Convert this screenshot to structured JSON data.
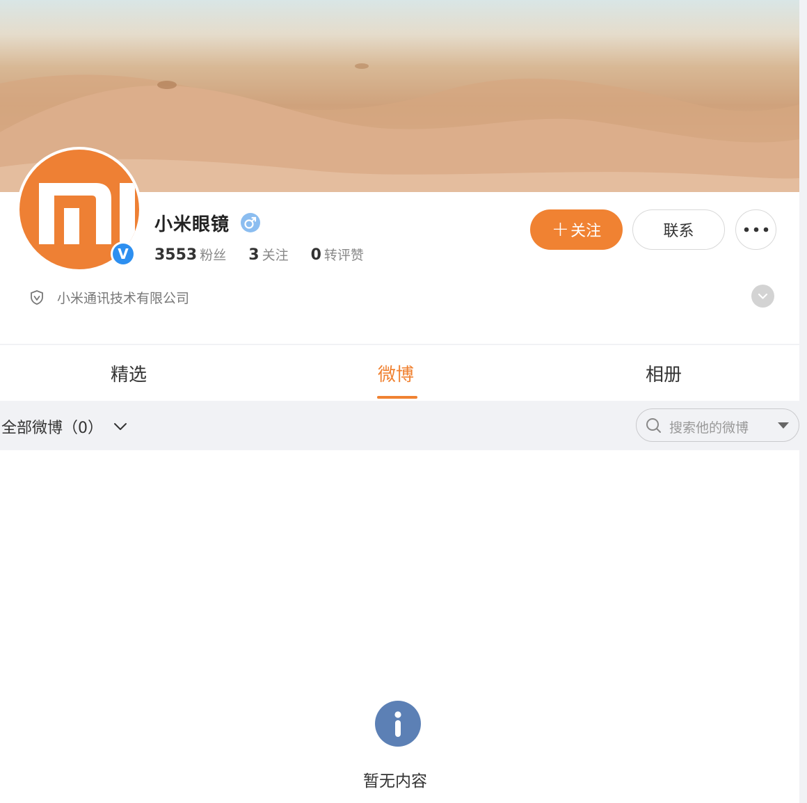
{
  "profile": {
    "name": "小米眼镜",
    "stats": [
      {
        "num": "3553",
        "label": "粉丝"
      },
      {
        "num": "3",
        "label": "关注"
      },
      {
        "num": "0",
        "label": "转评赞"
      }
    ],
    "company": "小米通讯技术有限公司"
  },
  "actions": {
    "follow_plus": "+",
    "follow_label": "关注",
    "contact_label": "联系"
  },
  "tabs": [
    {
      "label": "精选"
    },
    {
      "label": "微博"
    },
    {
      "label": "相册"
    }
  ],
  "filter": {
    "label": "全部微博（0）",
    "search_placeholder": "搜索他的微博"
  },
  "empty": {
    "text": "暂无内容"
  },
  "colors": {
    "accent": "#f08232",
    "avatar": "#ee8034",
    "verified": "#2d8ff0",
    "info_icon": "#5c80b5"
  },
  "icons": {
    "verified": "verified-v-icon",
    "gender": "male-gender-icon",
    "more": "more-dots-icon",
    "shield": "shield-icon",
    "expand": "chevron-down-icon",
    "search": "search-icon",
    "dropdown": "caret-down-icon",
    "empty": "info-icon"
  }
}
